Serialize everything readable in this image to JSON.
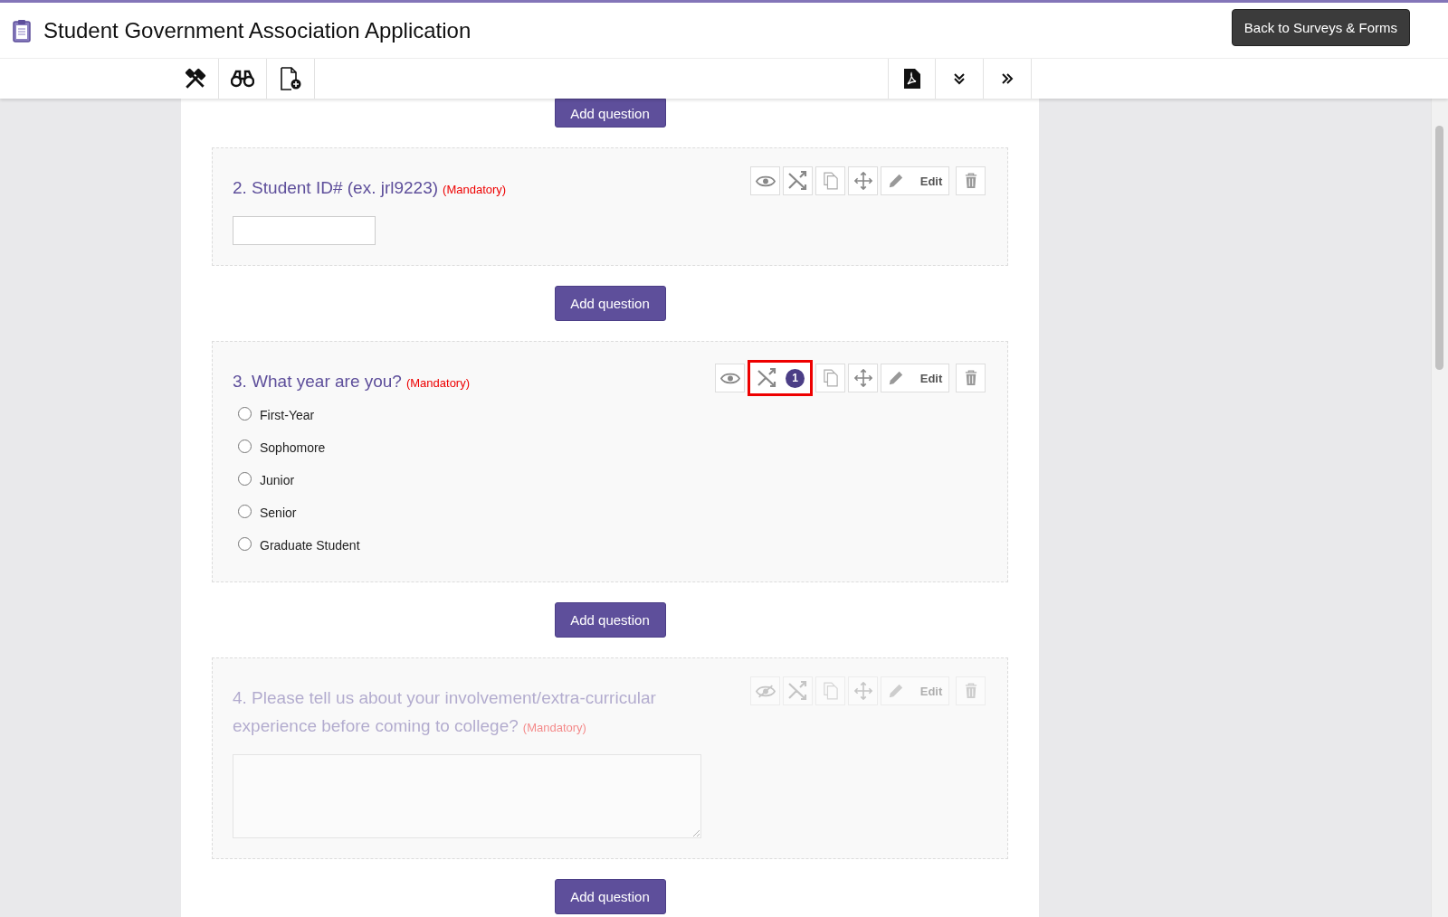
{
  "header": {
    "title": "Student Government Association Application",
    "back_button": "Back to Surveys & Forms"
  },
  "top_add_button": "Add question",
  "questions": [
    {
      "number_title": "2. Student ID# (ex. jrl9223)",
      "mandatory": "(Mandatory)",
      "kind": "short_text",
      "visible": true,
      "disabled": false,
      "edit_label": "Edit",
      "add_button_after": "Add question"
    },
    {
      "number_title": "3. What year are you?",
      "mandatory": "(Mandatory)",
      "kind": "radio",
      "visible": true,
      "disabled": false,
      "edit_label": "Edit",
      "logic_count": "1",
      "highlighted": true,
      "add_button_after": "Add question",
      "options": [
        {
          "label": "First-Year",
          "selected": false
        },
        {
          "label": "Sophomore",
          "selected": false
        },
        {
          "label": "Junior",
          "selected": false
        },
        {
          "label": "Senior",
          "selected": false
        },
        {
          "label": "Graduate Student",
          "selected": false
        }
      ]
    },
    {
      "number_title": "4. Please tell us about your involvement/extra-curricular experience before coming to college?",
      "mandatory": "(Mandatory)",
      "kind": "long_text",
      "visible": false,
      "disabled": true,
      "edit_label": "Edit",
      "add_button_after": "Add question"
    }
  ]
}
